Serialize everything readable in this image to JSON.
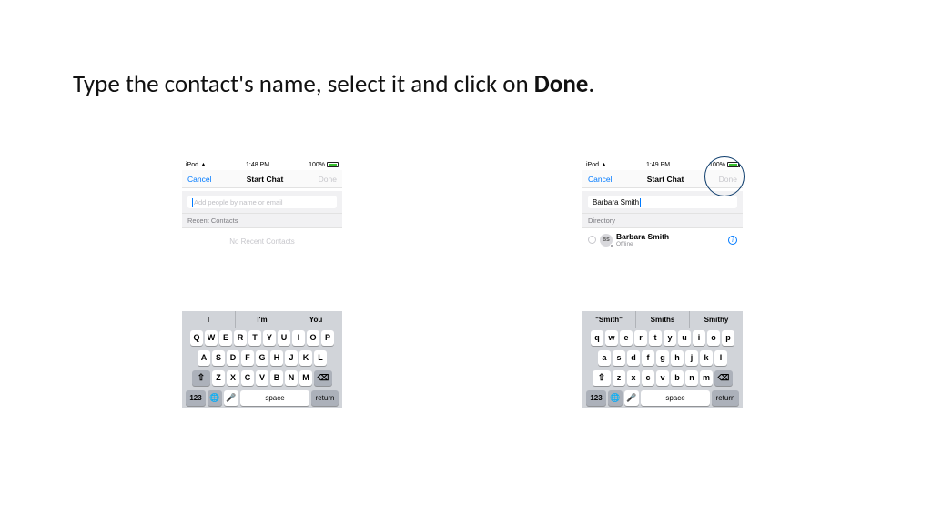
{
  "instruction": {
    "prefix": "Type the contact's name, select it and click on ",
    "bold": "Done",
    "suffix": "."
  },
  "status": {
    "device": "iPod",
    "time_left": "1:48 PM",
    "time_right": "1:49 PM",
    "battery_pct": "100%"
  },
  "nav": {
    "cancel": "Cancel",
    "title": "Start Chat",
    "done": "Done"
  },
  "left_screen": {
    "placeholder": "Add people by name or email",
    "section": "Recent Contacts",
    "empty": "No Recent Contacts"
  },
  "right_screen": {
    "search_value": "Barbara Smith",
    "section": "Directory",
    "contact": {
      "initials": "BS",
      "name": "Barbara Smith",
      "status": "Offline"
    }
  },
  "keyboard_left": {
    "suggestions": [
      "I",
      "I'm",
      "You"
    ],
    "row1": [
      "Q",
      "W",
      "E",
      "R",
      "T",
      "Y",
      "U",
      "I",
      "O",
      "P"
    ],
    "row2": [
      "A",
      "S",
      "D",
      "F",
      "G",
      "H",
      "J",
      "K",
      "L"
    ],
    "row3": [
      "Z",
      "X",
      "C",
      "V",
      "B",
      "N",
      "M"
    ],
    "num": "123",
    "space": "space",
    "return": "return"
  },
  "keyboard_right": {
    "suggestions": [
      "\"Smith\"",
      "Smiths",
      "Smithy"
    ],
    "row1": [
      "q",
      "w",
      "e",
      "r",
      "t",
      "y",
      "u",
      "i",
      "o",
      "p"
    ],
    "row2": [
      "a",
      "s",
      "d",
      "f",
      "g",
      "h",
      "j",
      "k",
      "l"
    ],
    "row3": [
      "z",
      "x",
      "c",
      "v",
      "b",
      "n",
      "m"
    ],
    "num": "123",
    "space": "space",
    "return": "return"
  }
}
